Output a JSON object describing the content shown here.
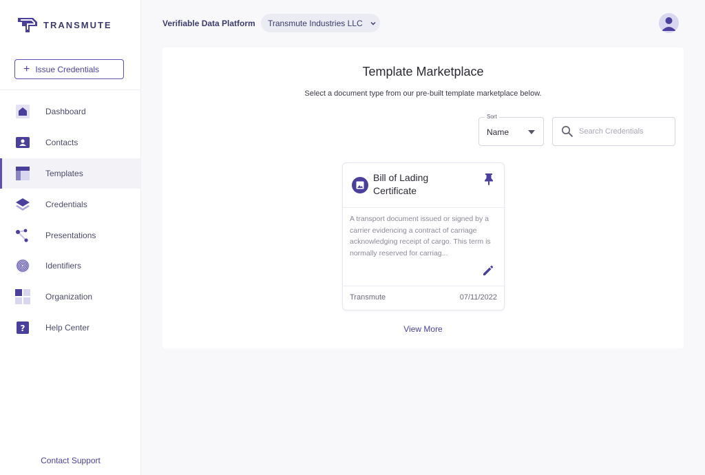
{
  "brand": {
    "name": "TRANSMUTE",
    "icon": "transmute-logo"
  },
  "sidebar": {
    "issue_button": {
      "label": "Issue Credentials",
      "icon": "plus-icon"
    },
    "items": [
      {
        "label": "Dashboard",
        "icon": "home-icon",
        "active": false
      },
      {
        "label": "Contacts",
        "icon": "contact-card-icon",
        "active": false
      },
      {
        "label": "Templates",
        "icon": "template-layout-icon",
        "active": true
      },
      {
        "label": "Credentials",
        "icon": "layers-icon",
        "active": false
      },
      {
        "label": "Presentations",
        "icon": "nodes-icon",
        "active": false
      },
      {
        "label": "Identifiers",
        "icon": "fingerprint-icon",
        "active": false
      },
      {
        "label": "Organization",
        "icon": "grid-icon",
        "active": false
      },
      {
        "label": "Help Center",
        "icon": "help-icon",
        "active": false
      }
    ],
    "contact_support": "Contact Support"
  },
  "header": {
    "platform_title": "Verifiable Data Platform",
    "org_selector": "Transmute Industries LLC",
    "avatar_icon": "user-avatar-icon"
  },
  "main": {
    "title": "Template Marketplace",
    "subtitle": "Select a document type from our pre-built template marketplace below.",
    "sort": {
      "label": "Sort",
      "value": "Name"
    },
    "search": {
      "placeholder": "Search Credentials",
      "value": ""
    },
    "templates": [
      {
        "title": "Bill of Lading Certificate",
        "description": "A transport document issued or signed by a carrier evidencing a contract of carriage acknowledging receipt of cargo. This term is normally reserved for carriag...",
        "author": "Transmute",
        "date": "07/11/2022",
        "icon": "image-icon"
      }
    ],
    "view_more": "View More"
  },
  "colors": {
    "accent": "#4b3f9e",
    "accent_light": "#d9d7ef",
    "background": "#f8f8fb"
  }
}
